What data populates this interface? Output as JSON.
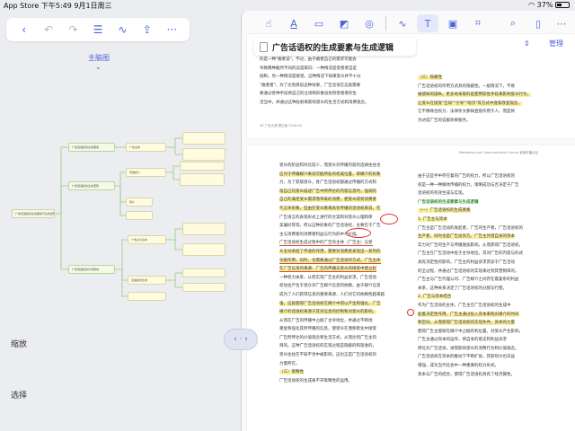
{
  "status": {
    "left": "App Store  下午5:49  9月1日周三",
    "right": "37%"
  },
  "left_toolbar": {
    "icons": [
      "back-icon",
      "undo-icon",
      "redo-icon",
      "list-icon",
      "pen-icon",
      "share-icon",
      "more-icon"
    ]
  },
  "mindmap": {
    "title": "主脑图",
    "root": "广告话语权的生成要素与生成逻辑",
    "nodes": [
      "广告话语权的生成要素",
      "广告话语权的生成逻辑",
      "广告话语权的价值取向",
      "广告主体",
      "传播媒介",
      "受众",
      "广告主与资本",
      "话语权的生成"
    ]
  },
  "side_buttons": {
    "zoom": "缩放",
    "select": "选择"
  },
  "toggle_label": "‹ · ›",
  "right_toolbar": {
    "icons": [
      "pointer-icon",
      "text-icon",
      "rect-icon",
      "mask-icon",
      "stamp-icon",
      "pen-icon",
      "textbox-icon",
      "image-icon",
      "link-icon",
      "search-icon",
      "bookmark-icon",
      "more-icon"
    ]
  },
  "doc": {
    "title": "广告话语权的生成要素与生成逻辑",
    "sort": "⇕",
    "manage": "管理",
    "page1": {
      "left_lines": [
        "的是一种\"瘾者说\"，不过，由于瘾者自己的需求可能会",
        "导致两种截然不同的态度取向：一种情况是受者者自是",
        "抵制，另一种情况是接受。这种情况下如果受众并不十分",
        "\"瘾者者\"，为了达到目前这种效果，广告话语在这类需要",
        "要通过各种手段将自己的立场和形象投射到受者者的生",
        "活当中，并通过这种投射来影响受众的生活方式和消费观念。"
      ],
      "right_lines": [
        "（三）隐蔽性",
        "广告话语权的作用方式具有隐蔽性。一般情况下，不易",
        "被感知的操纵。更多地采取的是使用软性手段来影响受众行为，",
        "让受众在接受\"告知\"\"引导\"\"暗示\"等方式中逐渐改变观念，",
        "它不像政治权力、法律条文那样直接作用于人，而是将",
        "为达成广告的说服效果服务。"
      ],
      "footer": "58  广告大观 理论版  2018.08"
    },
    "page2": {
      "header": "Marketing and Communication Forum 营销传播论坛",
      "left_lines": [
        "受众的阶层和对比较少，而受众对传播内容的选择往往也",
        "应对于传播媒介来说可能所处的权威位置，即媒介的形象",
        "力，为了获取受众，各广告话语权都通过传播的方式和",
        "指自己向受众描述广告中所传达的内容信息时，强调的",
        "自己的满足受众需求而带来的消费，使受众得到消费者",
        "代言体形象。但由在受众看来具有传播的话语权来说，在",
        "广告语言的表现形式上进行的文案和对受众心理和审",
        "美偏好等等。所以这种形象的广告话语权，主要在于广告",
        "主与消费者的消费者利益与行为的中介价值。",
        "广告话语权生成过程中的广告的主体（广告主）与受",
        "众主动承担了传递的作用，需要对消费者表现出一系列的",
        "功能作用。同时，也需要通过广告话语的方式，广告主体",
        "在广告信息的来源、广告的传播与受众的接受中建立起",
        "一种权力关系，从而实现广告主的利益诉求。广告话语",
        "权往往产生于受众对广告媒介信息的依赖，由于媒介信息",
        "成为了人们获得信息的重要来源，人们对它的依赖性越来越",
        "强，这就使得广告话语权在媒介中得以产生和强化，广告",
        "媒介的话语权来源于其对信息的控制和对受众的影响，",
        "从而在广告的传播中占据了主导地位，并通过不断地",
        "重复和强化其所传播的信息，使受众在潜移默化中接受",
        "广告所传达的价值观念和生活方式，从而达到广告主的",
        "目的。这种广告话语权的实现过程是隐蔽的和渐进的，",
        "受众往往在不知不觉中被影响，这也正是广告话语权的",
        "力量所在。",
        "（三）策略性",
        "广告话语权的生成离不开策略性的运用。"
      ],
      "right_lines": [
        "由于这些手中存在着的广告的权力，所以广告话语权的",
        "权是一种一种媒体传播的权力，策略成功与否决定于广告",
        "话语权的有效生成与实现。",
        "",
        "广告话语权的生成要素与生成逻辑",
        "",
        "（一）广告话语权的生成要素",
        "1. 广告主与资本",
        "广告主是广告活动的发起者，广告的生产者，广告话语权的",
        "生产者，同时也是广告投资方。广告主凭借自身的资本",
        "实力对广告的生产与传播施加影响，从而获得广告话语权，",
        "广告主在广告活动中处于主导地位，其对广告的内容与形式",
        "具有决定性的影响，广告主的利益诉求贯穿于广告活动",
        "的全过程，并通过广告话语权的实现来达到其营销目的。",
        "广告主与广告代理公司、广告媒介之间存在着复杂的利益",
        "关系，这种关系决定了广告话语权的分配与行使。",
        "2. 广告与资本结合",
        "作为广告活动的主体，广告主在广告话语权的生成中",
        "起着决定性作用。广告主通过投入资本来购买媒介的时间",
        "和空间，从而获得广告话语权的实现条件。资本的力量",
        "使得广告主能够在媒介中占据有利位置，对受众产生影响，",
        "广告主通过资本的运作，将自身的意志和利益诉求",
        "转化为广告话语，进而影响受众的消费行为和价值观念。",
        "广告话语权在资本的推动下不断扩张，其影响力也日益",
        "增强，成为当代社会中一种重要的权力形式。",
        "资本与广告的结合，使得广告话语权具有了经济属性。"
      ]
    }
  }
}
